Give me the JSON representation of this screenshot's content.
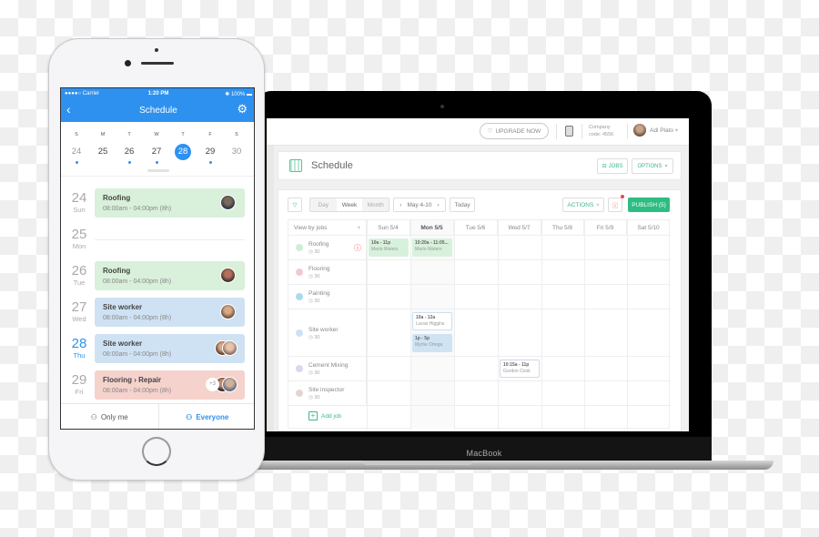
{
  "laptop": {
    "brand_label": "MacBook",
    "appbar": {
      "upgrade_label": "UPGRADE NOW",
      "company_label": "Company",
      "company_code": "code: 4556",
      "user_name": "Adi Plato"
    },
    "page_header": {
      "title": "Schedule",
      "jobs_label": "JOBS",
      "options_label": "OPTIONS"
    },
    "toolbar": {
      "view_modes": [
        "Day",
        "Week",
        "Month"
      ],
      "active_view": "Week",
      "date_range": "May 4-10",
      "today_label": "Today",
      "actions_label": "ACTIONS",
      "publish_label": "PUBLISH (5)"
    },
    "grid": {
      "first_header": "View by jobs",
      "days": [
        "Sun 5/4",
        "Mon 5/5",
        "Tue 5/6",
        "Wed 5/7",
        "Thu 5/8",
        "Fri 5/9",
        "Sat 5/10"
      ],
      "highlight_day": "Mon 5/5",
      "jobs": [
        {
          "name": "Roofing",
          "count": "30",
          "color": "#cfeed6",
          "alert": true
        },
        {
          "name": "Flooring",
          "count": "30",
          "color": "#f1c9cf"
        },
        {
          "name": "Painting",
          "count": "30",
          "color": "#a9dcea"
        },
        {
          "name": "Site worker",
          "count": "30",
          "color": "#cfe2f4"
        },
        {
          "name": "Cement Mixing",
          "count": "30",
          "color": "#ddd6ee"
        },
        {
          "name": "Site inspector",
          "count": "30",
          "color": "#e3d5d3"
        }
      ],
      "shifts": [
        {
          "time": "10a - 11p",
          "person": "Mario Waters",
          "job": "Roofing",
          "day": "Sun 5/4"
        },
        {
          "time": "10:20a - 11:05...",
          "person": "Mario Waters",
          "job": "Roofing",
          "day": "Mon 5/5"
        },
        {
          "time": "10a - 12a",
          "person": "Lucas Higgins",
          "job": "Site worker",
          "day": "Mon 5/5"
        },
        {
          "time": "1p - 5p",
          "person": "Myrtie Ortega",
          "job": "Site worker",
          "day": "Mon 5/5"
        },
        {
          "time": "10:15a - 11p",
          "person": "Gordon Cook",
          "job": "Cement Mixing",
          "day": "Wed 5/7"
        }
      ],
      "add_job_label": "Add job"
    }
  },
  "phone": {
    "status": {
      "carrier": "●●●●○ Carrier",
      "time": "1:20 PM",
      "battery": "100%"
    },
    "nav_title": "Schedule",
    "week_letters": [
      "S",
      "M",
      "T",
      "W",
      "T",
      "F",
      "S"
    ],
    "week_dates": [
      "24",
      "25",
      "26",
      "27",
      "28",
      "29",
      "30"
    ],
    "selected_date": "28",
    "days": [
      {
        "num": "24",
        "name": "Sun",
        "shift": "Roofing",
        "time": "08:00am - 04:00pm (8h)",
        "color": "#d9f0db"
      },
      {
        "num": "25",
        "name": "Mon"
      },
      {
        "num": "26",
        "name": "Tue",
        "shift": "Roofing",
        "time": "08:00am - 04:00pm (8h)",
        "color": "#d9f0db"
      },
      {
        "num": "27",
        "name": "Wed",
        "shift": "Site worker",
        "time": "08:00am - 04:00pm (8h)",
        "color": "#cfe2f3"
      },
      {
        "num": "28",
        "name": "Thu",
        "shift": "Site worker",
        "time": "08:00am - 04:00pm (8h)",
        "color": "#cfe2f3"
      },
      {
        "num": "29",
        "name": "Fri",
        "shift": "Flooring › Repair",
        "time": "08:00am - 04:00pm (8h)",
        "color": "#f5d2cc",
        "extra": "+3"
      }
    ],
    "tabs": {
      "only_me": "Only me",
      "everyone": "Everyone"
    }
  }
}
